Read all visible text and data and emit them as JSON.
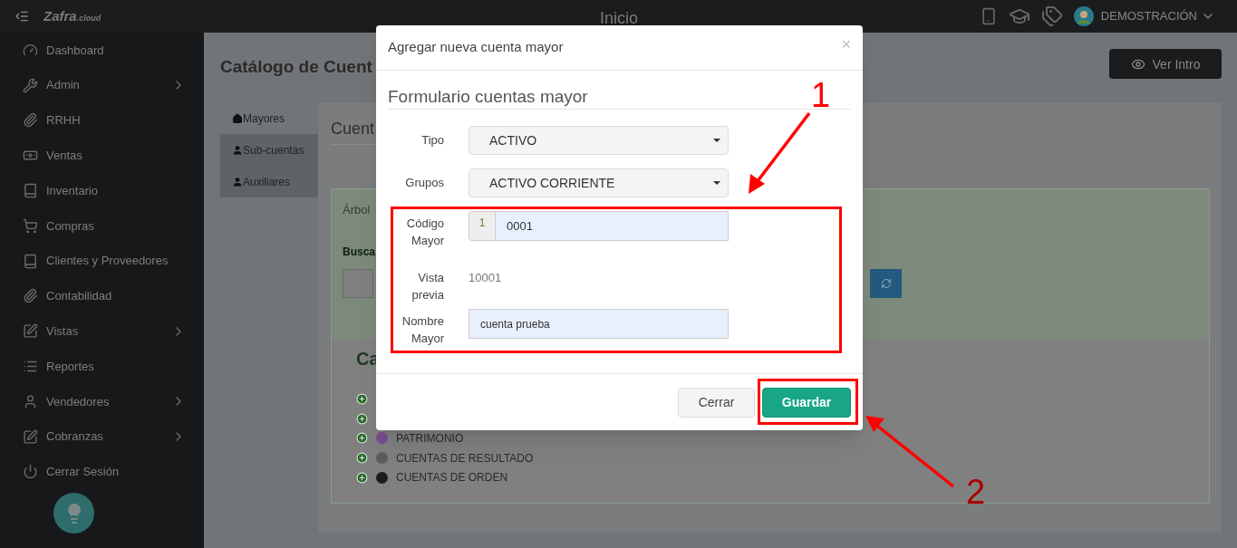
{
  "topbar": {
    "brand": "Zafra",
    "brand_suffix": ".cloud",
    "title": "Inicio",
    "user": "DEMOSTRACIÓN"
  },
  "sidebar": {
    "items": [
      {
        "label": "Dashboard",
        "kind": "gauge",
        "has_submenu": false
      },
      {
        "label": "Admin",
        "kind": "wrench",
        "has_submenu": true
      },
      {
        "label": "RRHH",
        "kind": "clip",
        "has_submenu": false
      },
      {
        "label": "Ventas",
        "kind": "money",
        "has_submenu": false
      },
      {
        "label": "Inventario",
        "kind": "book",
        "has_submenu": false
      },
      {
        "label": "Compras",
        "kind": "cart",
        "has_submenu": false
      },
      {
        "label": "Clientes y Proveedores",
        "kind": "book",
        "has_submenu": false
      },
      {
        "label": "Contabilidad",
        "kind": "clip",
        "has_submenu": false
      },
      {
        "label": "Vistas",
        "kind": "edit",
        "has_submenu": true
      },
      {
        "label": "Reportes",
        "kind": "list",
        "has_submenu": false
      },
      {
        "label": "Vendedores",
        "kind": "user",
        "has_submenu": true
      },
      {
        "label": "Cobranzas",
        "kind": "edit",
        "has_submenu": true
      },
      {
        "label": "Cerrar Sesión",
        "kind": "power",
        "has_submenu": false
      }
    ]
  },
  "page": {
    "title": "Catálogo de Cuent",
    "intro_button": "Ver Intro",
    "tabs": [
      {
        "label": "Mayores",
        "kind": "home",
        "selected": true
      },
      {
        "label": "Sub-cuentas",
        "kind": "user",
        "selected": false
      },
      {
        "label": "Auxiliares",
        "kind": "user",
        "selected": false
      }
    ],
    "section_title": "Cuent",
    "tree_panel": {
      "title": "Árbol",
      "search_label": "Busca",
      "heading": "Ca",
      "items": [
        {
          "expandable": true
        },
        {
          "expandable": true
        },
        {
          "expandable": true,
          "label": "PATRIMONIO",
          "color": "#7b4c93"
        },
        {
          "expandable": true,
          "label": "CUENTAS DE RESULTADO",
          "color": "#5c5c5c"
        },
        {
          "expandable": true,
          "label": "CUENTAS DE ORDEN",
          "color": "#1c1c1c"
        }
      ]
    }
  },
  "modal": {
    "title": "Agregar nueva cuenta mayor",
    "close": "×",
    "form_title": "Formulario cuentas mayor",
    "fields": [
      {
        "label": "Tipo",
        "kind": "select",
        "value": "ACTIVO"
      },
      {
        "label": "Grupos",
        "kind": "select",
        "value": "ACTIVO CORRIENTE"
      },
      {
        "label": "Código Mayor",
        "kind": "prefixed",
        "prefix": "1",
        "value": "0001"
      },
      {
        "label": "Vista previa",
        "kind": "static",
        "value": "10001"
      },
      {
        "label": "Nombre Mayor",
        "kind": "text",
        "value": "cuenta prueba"
      }
    ],
    "buttons": [
      {
        "label": "Cerrar",
        "kind": "default"
      },
      {
        "label": "Guardar",
        "kind": "primary"
      }
    ]
  },
  "annotations": [
    {
      "label": "1"
    },
    {
      "label": "2"
    }
  ]
}
